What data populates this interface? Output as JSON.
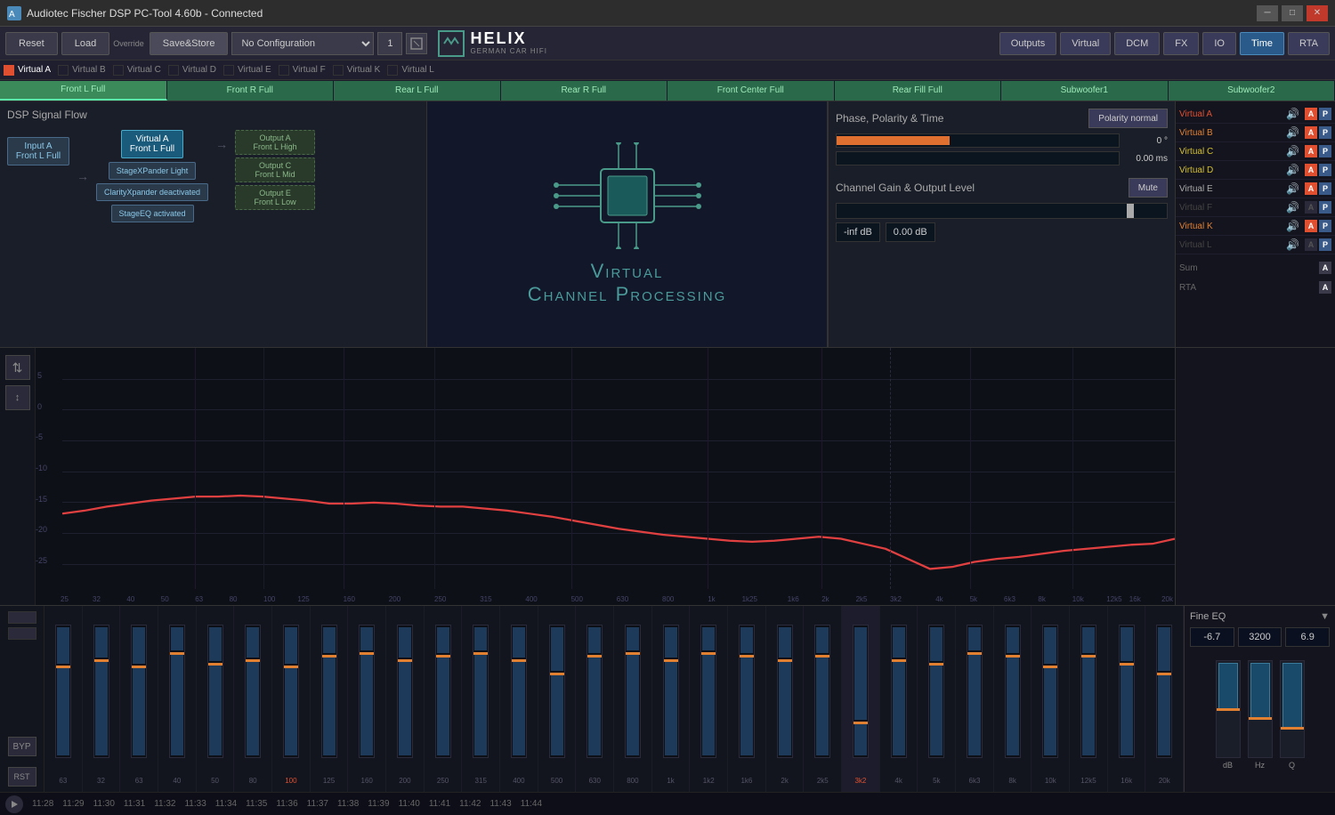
{
  "titlebar": {
    "title": "Audiotec Fischer DSP PC-Tool 4.60b - Connected",
    "controls": [
      "minimize",
      "maximize",
      "close"
    ]
  },
  "toolbar": {
    "reset_label": "Reset",
    "load_label": "Load",
    "override_label": "Override",
    "save_label": "Save&Store",
    "config_value": "No Configuration",
    "config_num": "1",
    "nav_buttons": [
      "Outputs",
      "Virtual",
      "DCM",
      "FX",
      "IO",
      "Time",
      "RTA"
    ],
    "active_nav": "Time"
  },
  "virtual_tabs": [
    {
      "label": "Virtual A",
      "dot": "red",
      "active": true
    },
    {
      "label": "Virtual B",
      "dot": "empty"
    },
    {
      "label": "Virtual C",
      "dot": "empty"
    },
    {
      "label": "Virtual D",
      "dot": "empty"
    },
    {
      "label": "Virtual E",
      "dot": "empty"
    },
    {
      "label": "Virtual F",
      "dot": "empty"
    },
    {
      "label": "Virtual K",
      "dot": "empty"
    },
    {
      "label": "Virtual L",
      "dot": "empty"
    }
  ],
  "channel_buttons": [
    "Front L Full",
    "Front R Full",
    "Rear L Full",
    "Rear R Full",
    "Front Center Full",
    "Rear Fill Full",
    "Subwoofer1",
    "Subwoofer2"
  ],
  "dsp_flow": {
    "title": "DSP Signal Flow",
    "input_node": {
      "line1": "Input A",
      "line2": "Front L Full"
    },
    "virtual_node": {
      "line1": "Virtual A",
      "line2": "Front L Full"
    },
    "processors": [
      "StageXPander Light",
      "ClarityXpander deactivated",
      "StageEQ activated"
    ],
    "outputs": [
      {
        "line1": "Output A",
        "line2": "Front L High"
      },
      {
        "line1": "Output C",
        "line2": "Front L Mid"
      },
      {
        "line1": "Output E",
        "line2": "Front L Low"
      }
    ]
  },
  "vcp": {
    "title": "Virtual",
    "title2": "Channel Processing"
  },
  "phase_panel": {
    "title": "Phase, Polarity & Time",
    "polarity_btn": "Polarity normal",
    "phase_value": "0 °",
    "time_value": "0.00 ms"
  },
  "channel_gain": {
    "title": "Channel Gain & Output Level",
    "mute_btn": "Mute",
    "gain_db1": "-inf dB",
    "gain_db2": "0.00 dB"
  },
  "rta_channels": [
    {
      "name": "Virtual A",
      "color": "active-red",
      "a": true,
      "p": true
    },
    {
      "name": "Virtual B",
      "color": "active-orange",
      "a": true,
      "p": true
    },
    {
      "name": "Virtual C",
      "color": "active-yellow",
      "a": true,
      "p": true
    },
    {
      "name": "Virtual D",
      "color": "active-yellow",
      "a": true,
      "p": true
    },
    {
      "name": "Virtual E",
      "color": "active-gray",
      "a": true,
      "p": true
    },
    {
      "name": "Virtual F",
      "color": "",
      "a": false,
      "p": true
    },
    {
      "name": "Virtual K",
      "color": "active-orange",
      "a": true,
      "p": true
    },
    {
      "name": "Virtual L",
      "color": "",
      "a": false,
      "p": true
    }
  ],
  "spectrum": {
    "y_labels": [
      "5",
      "0",
      "-5",
      "-10",
      "-15",
      "-20",
      "-25"
    ],
    "x_labels": [
      "25",
      "32",
      "40",
      "50",
      "63",
      "80",
      "100",
      "125",
      "160",
      "200",
      "250",
      "315",
      "400",
      "500",
      "630",
      "800",
      "1k",
      "1k25",
      "1k6",
      "2k",
      "2k5",
      "3k2",
      "4k",
      "5k",
      "6k3",
      "8k",
      "10k",
      "12k5",
      "16k",
      "20k"
    ]
  },
  "eq_bands": [
    {
      "freq": "63",
      "pos": 0.3,
      "highlighted": false
    },
    {
      "freq": "32",
      "pos": 0.25,
      "highlighted": false
    },
    {
      "freq": "63",
      "pos": 0.3,
      "highlighted": false
    },
    {
      "freq": "40",
      "pos": 0.2,
      "highlighted": false
    },
    {
      "freq": "50",
      "pos": 0.28,
      "highlighted": false
    },
    {
      "freq": "80",
      "pos": 0.25,
      "highlighted": false
    },
    {
      "freq": "100",
      "pos": 0.3,
      "highlighted": true
    },
    {
      "freq": "125",
      "pos": 0.22,
      "highlighted": false
    },
    {
      "freq": "160",
      "pos": 0.2,
      "highlighted": false
    },
    {
      "freq": "200",
      "pos": 0.25,
      "highlighted": false
    },
    {
      "freq": "250",
      "pos": 0.22,
      "highlighted": false
    },
    {
      "freq": "315",
      "pos": 0.2,
      "highlighted": false
    },
    {
      "freq": "400",
      "pos": 0.25,
      "highlighted": false
    },
    {
      "freq": "500",
      "pos": 0.35,
      "highlighted": false
    },
    {
      "freq": "630",
      "pos": 0.22,
      "highlighted": false
    },
    {
      "freq": "800",
      "pos": 0.2,
      "highlighted": false
    },
    {
      "freq": "1k",
      "pos": 0.25,
      "highlighted": false
    },
    {
      "freq": "1k2",
      "pos": 0.2,
      "highlighted": false
    },
    {
      "freq": "1k6",
      "pos": 0.22,
      "highlighted": false
    },
    {
      "freq": "2k",
      "pos": 0.25,
      "highlighted": false
    },
    {
      "freq": "2k5",
      "pos": 0.22,
      "highlighted": false
    },
    {
      "freq": "3k2",
      "pos": 0.72,
      "highlighted": true,
      "selected": true
    },
    {
      "freq": "4k",
      "pos": 0.25,
      "highlighted": false
    },
    {
      "freq": "5k",
      "pos": 0.28,
      "highlighted": false
    },
    {
      "freq": "6k3",
      "pos": 0.2,
      "highlighted": false
    },
    {
      "freq": "8k",
      "pos": 0.22,
      "highlighted": false
    },
    {
      "freq": "10k",
      "pos": 0.3,
      "highlighted": false
    },
    {
      "freq": "12k5",
      "pos": 0.22,
      "highlighted": false
    },
    {
      "freq": "16k",
      "pos": 0.28,
      "highlighted": false
    },
    {
      "freq": "20k",
      "pos": 0.35,
      "highlighted": false
    }
  ],
  "fine_eq": {
    "title": "Fine EQ",
    "db_value": "-6.7",
    "hz_value": "3200",
    "q_value": "6.9",
    "labels": [
      "dB",
      "Hz",
      "Q"
    ]
  },
  "timestamps": [
    "11:28",
    "11:29",
    "11:30",
    "11:31",
    "11:32",
    "11:33",
    "11:34",
    "11:35",
    "11:36",
    "11:37",
    "11:38",
    "11:39",
    "11:40",
    "11:41",
    "11:42",
    "11:43",
    "11:44"
  ]
}
